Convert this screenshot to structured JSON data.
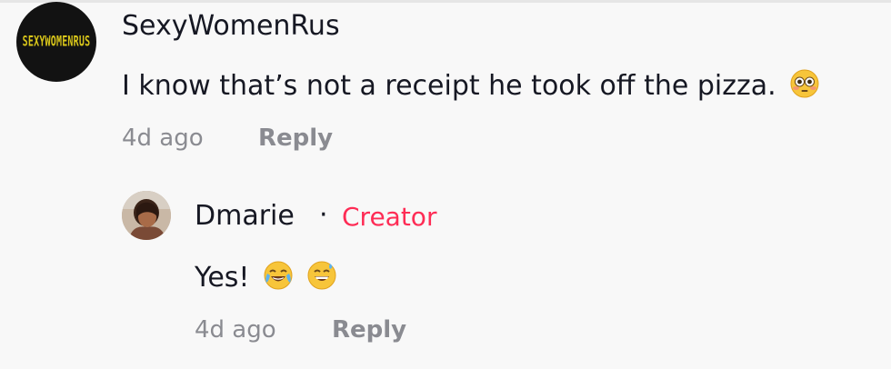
{
  "comment": {
    "avatar_text": "SEXYWOMENRUS",
    "username": "SexyWomenRus",
    "text": "I know that’s not a receipt he took off the pizza.",
    "text_emoji": "flushed-face-emoji",
    "time": "4d ago",
    "reply_label": "Reply"
  },
  "reply": {
    "username": "Dmarie",
    "separator": "·",
    "badge": "Creator",
    "text": "Yes!",
    "emojis": [
      "face-with-tears-of-joy-emoji",
      "grinning-face-with-sweat-emoji"
    ],
    "time": "4d ago",
    "reply_label": "Reply"
  },
  "colors": {
    "background": "#f8f8f8",
    "text": "#161823",
    "meta": "#8a8b91",
    "creator_badge": "#fe2c55",
    "logo_yellow": "#d9c61a"
  }
}
